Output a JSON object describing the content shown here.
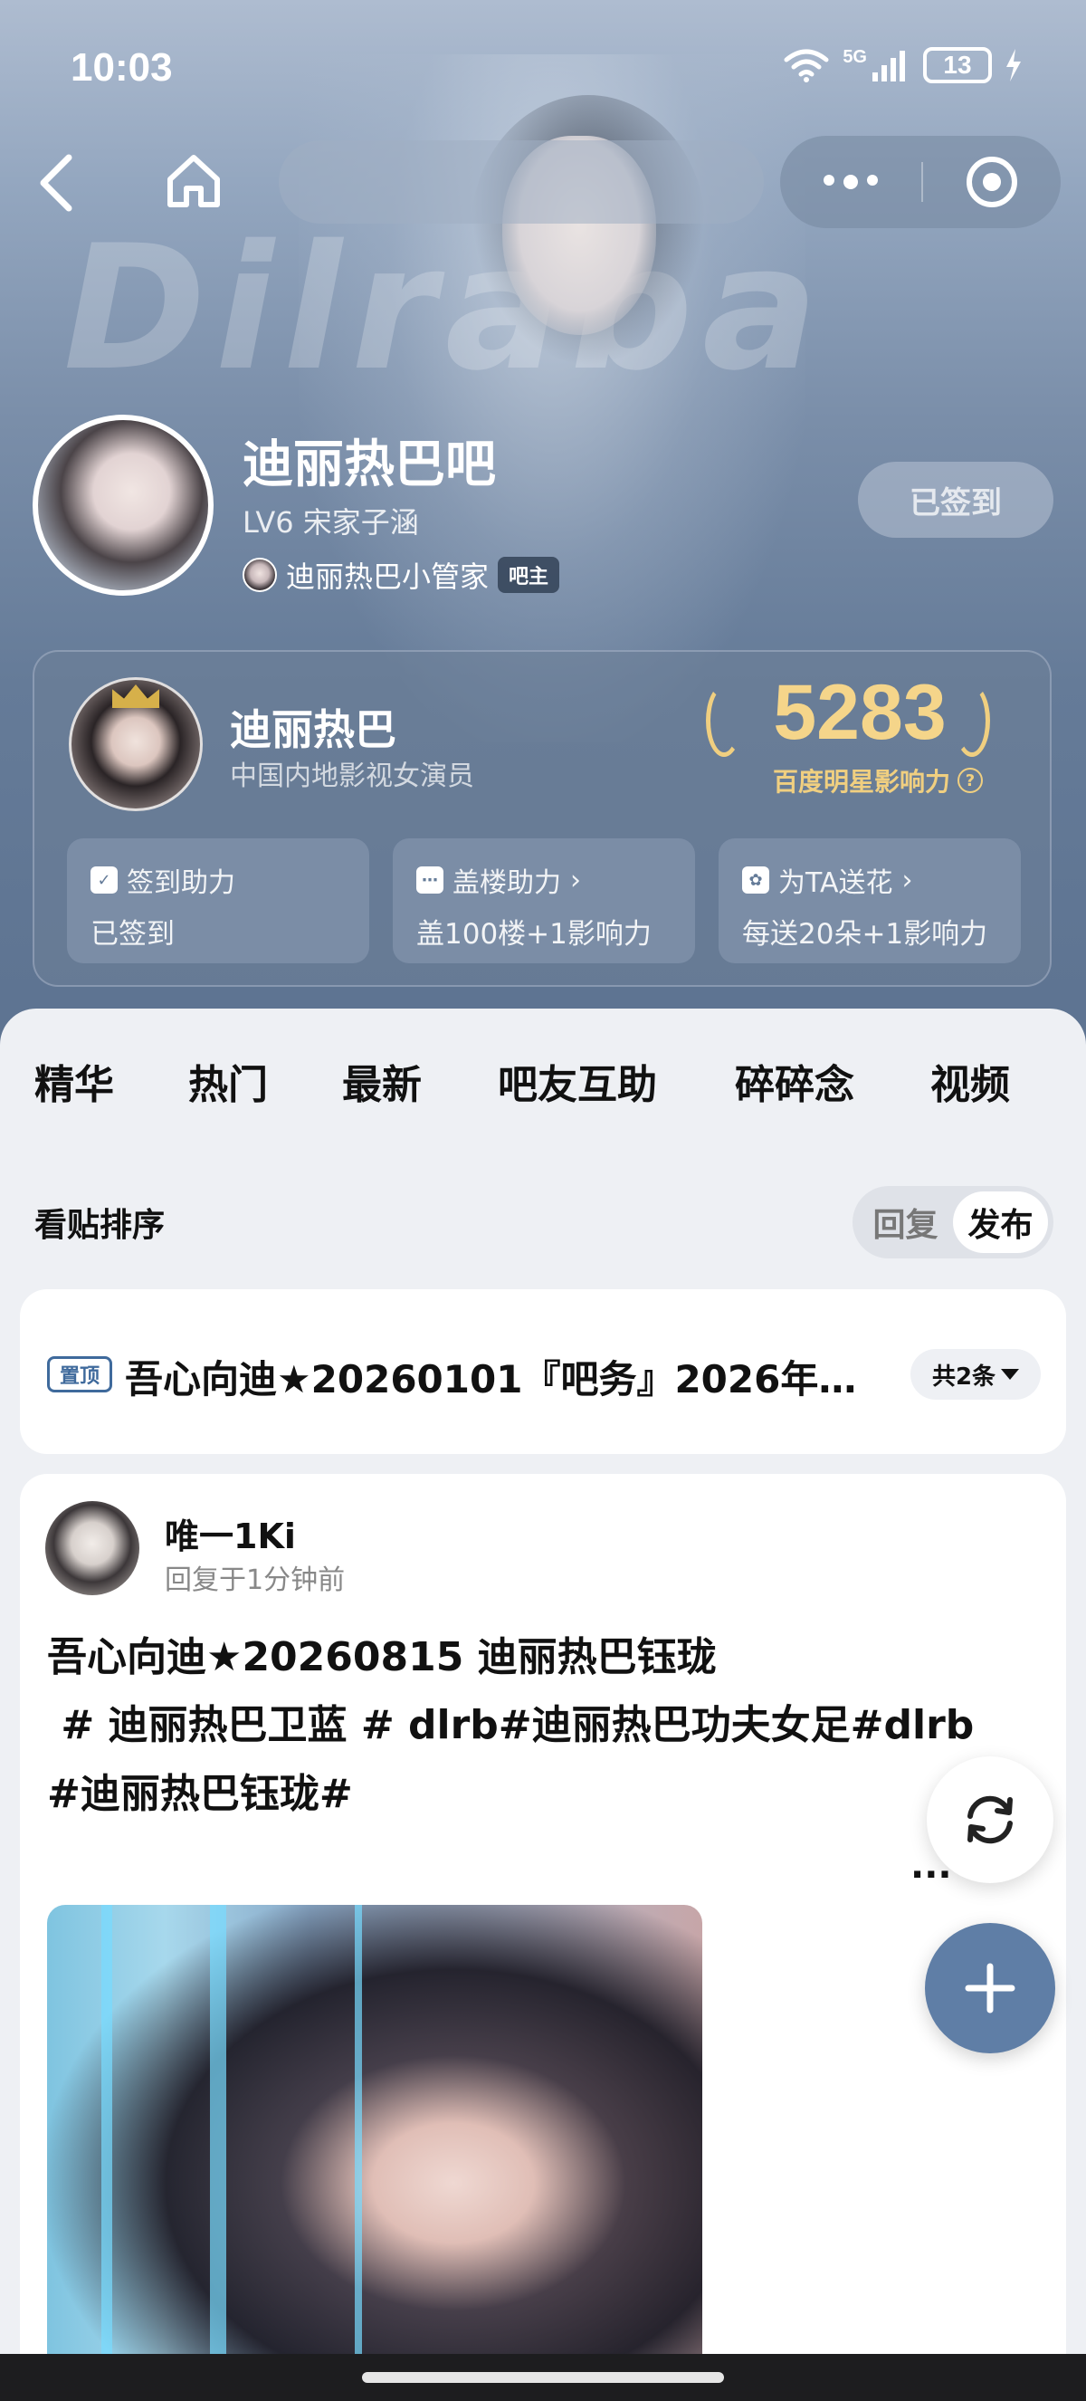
{
  "status_bar": {
    "time": "10:03",
    "network": "5G",
    "battery": "13"
  },
  "banner": {
    "watermark": "Dilraba"
  },
  "forum": {
    "title": "迪丽热巴吧",
    "level": "LV6 宋家子涵",
    "admin_name": "迪丽热巴小管家",
    "admin_badge": "吧主",
    "signed_label": "已签到"
  },
  "celebrity": {
    "name": "迪丽热巴",
    "description": "中国内地影视女演员",
    "influence_score": "5283",
    "influence_label": "百度明星影响力",
    "boosts": [
      {
        "icon": "calendar-check-icon",
        "title": "签到助力",
        "subtitle": "已签到",
        "has_arrow": false
      },
      {
        "icon": "chat-bubble-icon",
        "title": "盖楼助力",
        "subtitle": "盖100楼+1影响力",
        "has_arrow": true
      },
      {
        "icon": "flower-icon",
        "title": "为TA送花",
        "subtitle": "每送20朵+1影响力",
        "has_arrow": true
      }
    ]
  },
  "tabs": [
    "精华",
    "热门",
    "最新",
    "吧友互助",
    "碎碎念",
    "视频"
  ],
  "active_tab": "最新",
  "sort": {
    "label": "看贴排序",
    "options": [
      "回复",
      "发布"
    ],
    "selected": "发布"
  },
  "pinned": {
    "badge": "置顶",
    "title": "吾心向迪★20260101『吧务』2026年…",
    "count": "共2条"
  },
  "post": {
    "user": "唯一1Ki",
    "time": "回复于1分钟前",
    "title": "吾心向迪★20260815 迪丽热巴钰珑",
    "body_line1": " # 迪丽热巴卫蓝 # dlrb#迪丽热巴功夫女足#dlrb",
    "body_line2": "#迪丽热巴钰珑#",
    "more": "..."
  },
  "colors": {
    "accent": "#5f7ea6",
    "gold": "#f5d58a",
    "tab_underline": "#4a6a8f",
    "pin_blue": "#3f6a9c"
  }
}
